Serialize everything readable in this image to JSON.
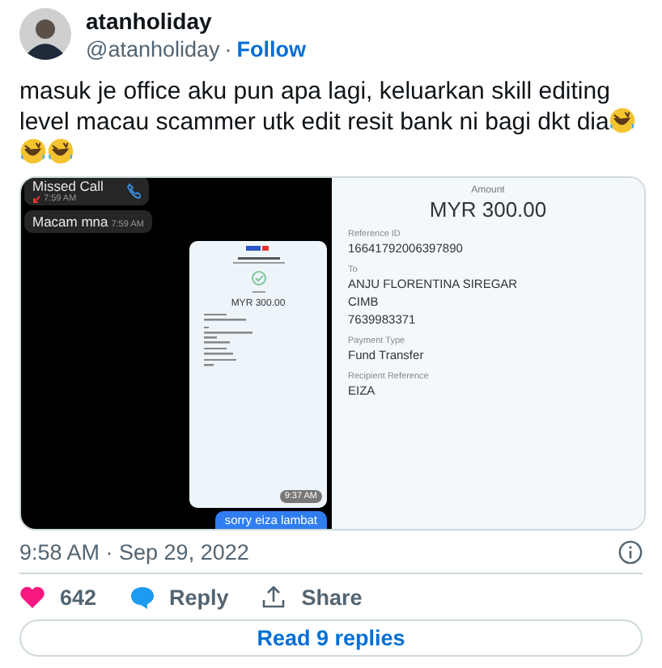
{
  "author": {
    "name": "atanholiday",
    "handle": "@atanholiday",
    "separator": "·",
    "follow": "Follow"
  },
  "text": "masuk je office aku pun apa lagi, keluarkan skill editing level macau scammer utk edit resit bank ni bagi dkt dia",
  "media": {
    "chat": {
      "messages": [
        {
          "kind": "call",
          "text": "Missed Call",
          "time": "7:59 AM"
        },
        {
          "kind": "text",
          "text": "Macam mna",
          "time": "7:59 AM"
        },
        {
          "kind": "image",
          "amount": "MYR 300.00",
          "time": "9:37 AM"
        },
        {
          "kind": "outgoing",
          "text": "sorry eiza lambat"
        }
      ]
    },
    "receipt": {
      "amount_label": "Amount",
      "amount": "MYR 300.00",
      "fields": [
        {
          "label": "Reference ID",
          "lines": [
            "16641792006397890"
          ]
        },
        {
          "label": "To",
          "lines": [
            "ANJU FLORENTINA SIREGAR",
            "CIMB",
            "7639983371"
          ]
        },
        {
          "label": "Payment Type",
          "lines": [
            "Fund Transfer"
          ]
        },
        {
          "label": "Recipient Reference",
          "lines": [
            "EIZA"
          ]
        }
      ]
    }
  },
  "timestamp": "9:58 AM · Sep 29, 2022",
  "actions": {
    "likes": "642",
    "reply": "Reply",
    "share": "Share"
  },
  "read_replies": "Read 9 replies"
}
